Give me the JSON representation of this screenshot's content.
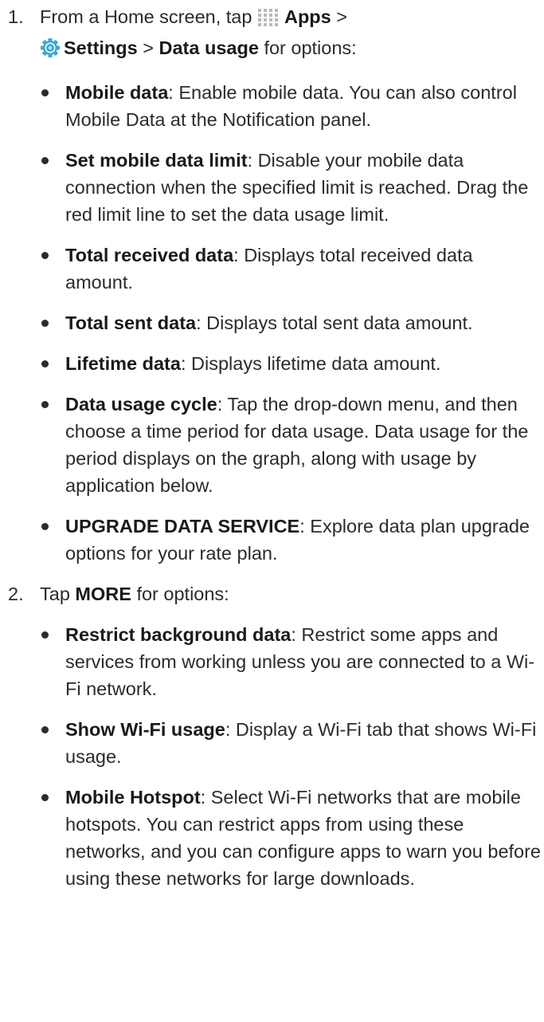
{
  "steps": [
    {
      "number": "1.",
      "line1_prefix": "From a Home screen, tap",
      "apps_label": "Apps",
      "sep1": ">",
      "settings_label": "Settings",
      "sep2": ">",
      "data_usage_label": "Data usage",
      "line_suffix": "for options:",
      "bullets": [
        {
          "term": "Mobile data",
          "desc": ": Enable mobile data. You can also control Mobile Data at the Notification panel."
        },
        {
          "term": "Set mobile data limit",
          "desc": ": Disable your mobile data connection when the specified limit is reached. Drag the red limit line to set the data usage limit."
        },
        {
          "term": "Total received data",
          "desc": ": Displays total received data amount."
        },
        {
          "term": "Total sent data",
          "desc": ": Displays total sent data amount."
        },
        {
          "term": "Lifetime data",
          "desc": ": Displays lifetime data amount."
        },
        {
          "term": "Data usage cycle",
          "desc": ": Tap the drop-down menu, and then choose a time period for data usage. Data usage for the period displays on the graph, along with usage by application below."
        },
        {
          "term": "UPGRADE DATA SERVICE",
          "desc": ": Explore data plan upgrade options for your rate plan."
        }
      ]
    },
    {
      "number": "2.",
      "prefix": "Tap",
      "more_label": "MORE",
      "suffix": "for options:",
      "bullets": [
        {
          "term": "Restrict background data",
          "desc": ": Restrict some apps and services from working unless you are connected to a Wi-Fi network."
        },
        {
          "term": "Show Wi-Fi usage",
          "desc": ": Display a Wi-Fi tab that shows Wi-Fi usage."
        },
        {
          "term": "Mobile Hotspot",
          "desc": ": Select Wi-Fi networks that are mobile hotspots. You can restrict apps from using these networks, and you can configure apps to warn you before using these networks for large downloads."
        }
      ]
    }
  ],
  "icons": {
    "apps": "apps-grid-icon",
    "settings": "settings-gear-icon"
  },
  "colors": {
    "apps_icon": "#b9b9b9",
    "settings_icon": "#39a9d6"
  }
}
